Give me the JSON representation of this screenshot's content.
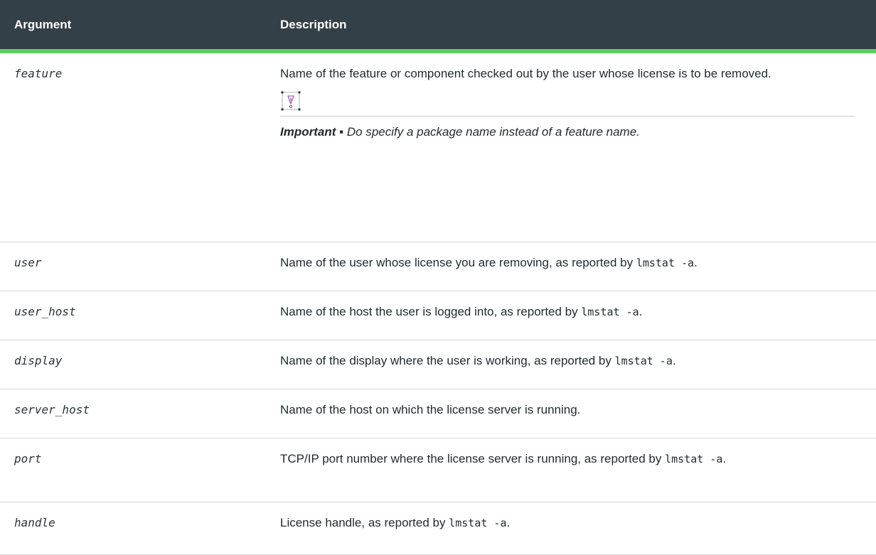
{
  "headers": {
    "argument": "Argument",
    "description": "Description"
  },
  "rows": [
    {
      "key": "feature",
      "name": "feature",
      "desc_before": "Name of the feature or component checked out by the user whose license is to be removed.",
      "note": {
        "icon": "important-icon",
        "label": "Important ▪",
        "text": " Do specify a package name instead of a feature name."
      }
    },
    {
      "key": "user",
      "name": "user",
      "desc_before": "Name of the user whose license you are removing, as reported by ",
      "code": "lmstat -a",
      "desc_after": "."
    },
    {
      "key": "user_host",
      "name": "user_host",
      "desc_before": "Name of the host the user is logged into, as reported by ",
      "code": "lmstat -a",
      "desc_after": "."
    },
    {
      "key": "display",
      "name": "display",
      "desc_before": "Name of the display where the user is working, as reported by ",
      "code": "lmstat -a",
      "desc_after": "."
    },
    {
      "key": "server_host",
      "name": "server_host",
      "desc_before": "Name of the host on which the license server is running."
    },
    {
      "key": "port",
      "name": "port",
      "desc_before": "TCP/IP port number where the license server is running, as reported by ",
      "code": "lmstat -a",
      "desc_after": "."
    },
    {
      "key": "handle",
      "name": "handle",
      "desc_before": "License handle, as reported by ",
      "code": "lmstat -a",
      "desc_after": "."
    }
  ],
  "colors": {
    "header_bg": "#344047",
    "header_accent": "#5ad15f",
    "icon_stroke": "#9b3fa6"
  }
}
